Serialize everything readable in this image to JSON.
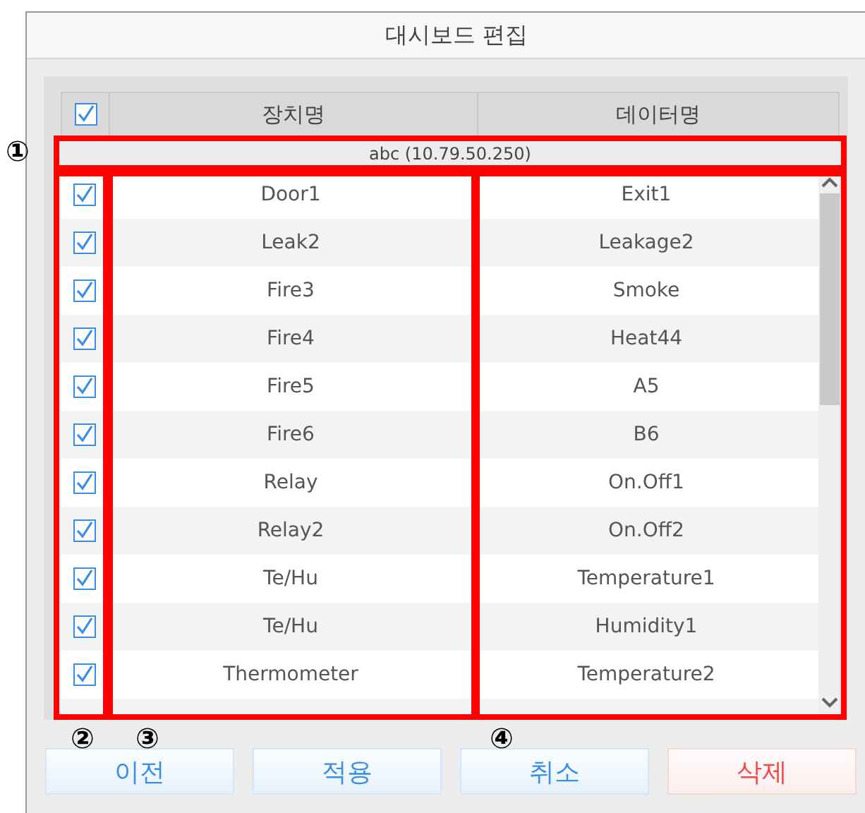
{
  "window": {
    "title": "대시보드 편집"
  },
  "table": {
    "header_checked": true,
    "columns": [
      "장치명",
      "데이터명"
    ],
    "group": "abc (10.79.50.250)",
    "rows": [
      {
        "checked": true,
        "device": "Door1",
        "data": "Exit1"
      },
      {
        "checked": true,
        "device": "Leak2",
        "data": "Leakage2"
      },
      {
        "checked": true,
        "device": "Fire3",
        "data": "Smoke"
      },
      {
        "checked": true,
        "device": "Fire4",
        "data": "Heat44"
      },
      {
        "checked": true,
        "device": "Fire5",
        "data": "A5"
      },
      {
        "checked": true,
        "device": "Fire6",
        "data": "B6"
      },
      {
        "checked": true,
        "device": "Relay",
        "data": "On.Off1"
      },
      {
        "checked": true,
        "device": "Relay2",
        "data": "On.Off2"
      },
      {
        "checked": true,
        "device": "Te/Hu",
        "data": "Temperature1"
      },
      {
        "checked": true,
        "device": "Te/Hu",
        "data": "Humidity1"
      },
      {
        "checked": true,
        "device": "Thermometer",
        "data": "Temperature2"
      }
    ]
  },
  "buttons": [
    {
      "label": "이전",
      "kind": "normal"
    },
    {
      "label": "적용",
      "kind": "normal"
    },
    {
      "label": "취소",
      "kind": "normal"
    },
    {
      "label": "삭제",
      "kind": "danger"
    }
  ],
  "callouts": [
    {
      "label": "①"
    },
    {
      "label": "②"
    },
    {
      "label": "③"
    },
    {
      "label": "④"
    }
  ]
}
